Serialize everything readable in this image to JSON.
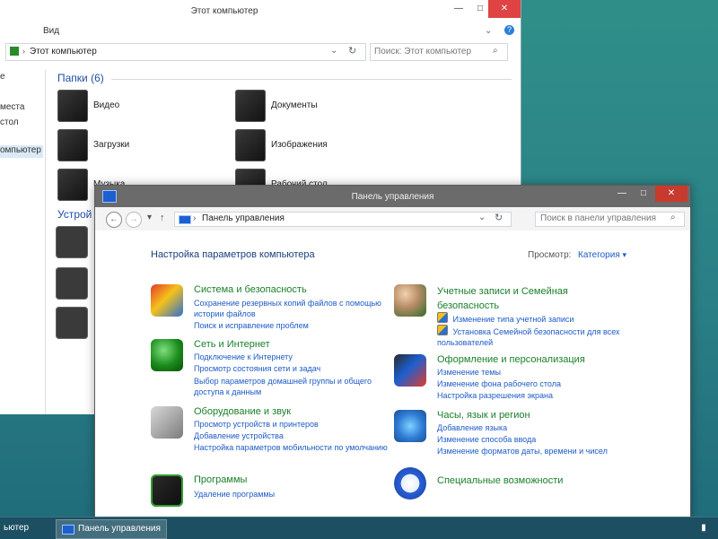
{
  "explorer": {
    "title": "Этот компьютер",
    "menu": [
      "Вид"
    ],
    "address": "Этот компьютер",
    "search_placeholder": "Поиск: Этот компьютер",
    "sidebar_items": [
      "е",
      "места",
      "стол",
      "омпьютер"
    ],
    "groups": {
      "folders": "Папки (6)",
      "devices": "Устрой"
    },
    "folders": [
      "Видео",
      "Документы",
      "Загрузки",
      "Изображения",
      "Музыка",
      "Рабочий стол"
    ]
  },
  "control_panel": {
    "title": "Панель управления",
    "address": "Панель управления",
    "search_placeholder": "Поиск в панели управления",
    "heading": "Настройка параметров компьютера",
    "view_label": "Просмотр:",
    "view_value": "Категория",
    "categories": [
      {
        "title": "Система и безопасность",
        "links": [
          "Сохранение резервных копий файлов с помощью истории файлов",
          "Поиск и исправление проблем"
        ]
      },
      {
        "title": "Сеть и Интернет",
        "links": [
          "Подключение к Интернету",
          "Просмотр состояния сети и задач",
          "Выбор параметров домашней группы и общего доступа к данным"
        ]
      },
      {
        "title": "Оборудование и звук",
        "links": [
          "Просмотр устройств и принтеров",
          "Добавление устройства",
          "Настройка параметров мобильности по умолчанию"
        ]
      },
      {
        "title": "Программы",
        "links": [
          "Удаление программы"
        ]
      },
      {
        "title": "Учетные записи и Семейная безопасность",
        "links": [
          "Изменение типа учетной записи",
          "Установка Семейной безопасности для всех пользователей"
        ]
      },
      {
        "title": "Оформление и персонализация",
        "links": [
          "Изменение темы",
          "Изменение фона рабочего стола",
          "Настройка разрешения экрана"
        ]
      },
      {
        "title": "Часы, язык и регион",
        "links": [
          "Добавление языка",
          "Изменение способа ввода",
          "Изменение форматов даты, времени и чисел"
        ]
      },
      {
        "title": "Специальные возможности",
        "links": []
      }
    ]
  },
  "taskbar": {
    "item1": "ьютер",
    "item2": "Панель управления"
  },
  "colors": {
    "accent_green": "#1a7f2a",
    "link_blue": "#1e5bc6",
    "heading_blue": "#1a3f7b",
    "titlebar_gray": "#6b6b6b",
    "close_red": "#c83a2d"
  }
}
